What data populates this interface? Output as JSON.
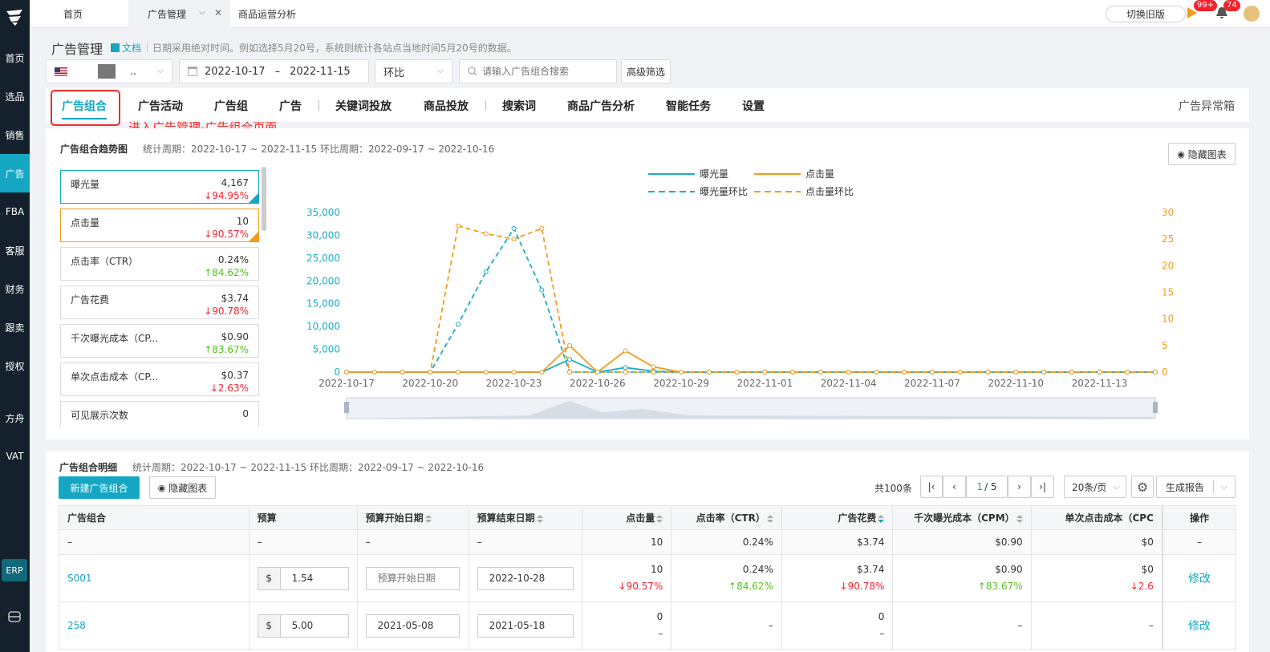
{
  "sidebar": {
    "items": [
      {
        "label": "首页",
        "active": false
      },
      {
        "label": "选品",
        "active": false
      },
      {
        "label": "销售",
        "active": false
      },
      {
        "label": "广告",
        "active": true
      },
      {
        "label": "FBA",
        "active": false
      },
      {
        "label": "客服",
        "active": false
      },
      {
        "label": "财务",
        "active": false
      },
      {
        "label": "跟卖",
        "active": false
      },
      {
        "label": "授权",
        "active": false
      },
      {
        "label": "方舟",
        "active": false
      },
      {
        "label": "VAT",
        "active": false
      }
    ],
    "erp_label": "ERP"
  },
  "tabs": [
    {
      "label": "首页"
    },
    {
      "label": "广告管理",
      "active": true
    },
    {
      "label": "商品运营分析"
    }
  ],
  "topbar": {
    "switch_old_label": "切换旧版",
    "badge_play": "99+",
    "badge_bell": "74"
  },
  "header": {
    "title": "广告管理",
    "doc_label": "文档",
    "hint": "日期采用绝对时间。例如选择5月20号，系统则统计各站点当地时间5月20号的数据。"
  },
  "filters": {
    "store_suffix": "..",
    "date_start": "2022-10-17",
    "date_sep": "–",
    "date_end": "2022-11-15",
    "compare": "环比",
    "search_placeholder": "请输入广告组合搜索",
    "advanced_label": "高级筛选"
  },
  "nav": [
    {
      "label": "广告组合",
      "active": true
    },
    {
      "label": "广告活动"
    },
    {
      "label": "广告组"
    },
    {
      "label": "广告"
    },
    {
      "label": "关键词投放"
    },
    {
      "label": "商品投放"
    },
    {
      "label": "搜索词"
    },
    {
      "label": "商品广告分析"
    },
    {
      "label": "智能任务"
    },
    {
      "label": "设置"
    }
  ],
  "nav_right": "广告异常箱",
  "annotation": "进入广告管理-广告组合页面",
  "trend": {
    "title": "广告组合趋势图",
    "meta": "统计周期：2022-10-17 ~ 2022-11-15 环比周期：2022-09-17 ~ 2022-10-16",
    "hide_label": "隐藏图表",
    "metrics": [
      {
        "name": "曝光量",
        "value": "4,167",
        "change": "↓94.95%",
        "dir": "down"
      },
      {
        "name": "点击量",
        "value": "10",
        "change": "↓90.57%",
        "dir": "down"
      },
      {
        "name": "点击率（CTR）",
        "value": "0.24%",
        "change": "↑84.62%",
        "dir": "up"
      },
      {
        "name": "广告花费",
        "value": "$3.74",
        "change": "↓90.78%",
        "dir": "down"
      },
      {
        "name": "千次曝光成本（CP...",
        "value": "$0.90",
        "change": "↑83.67%",
        "dir": "up"
      },
      {
        "name": "单次点击成本（CP...",
        "value": "$0.37",
        "change": "↓2.63%",
        "dir": "down"
      },
      {
        "name": "可见展示次数",
        "value": "0",
        "change": "–",
        "dir": "none"
      }
    ]
  },
  "chart_data": {
    "type": "line",
    "x": [
      "2022-10-17",
      "2022-10-18",
      "2022-10-19",
      "2022-10-20",
      "2022-10-21",
      "2022-10-22",
      "2022-10-23",
      "2022-10-24",
      "2022-10-25",
      "2022-10-26",
      "2022-10-27",
      "2022-10-28",
      "2022-10-29",
      "2022-10-30",
      "2022-10-31",
      "2022-11-01",
      "2022-11-02",
      "2022-11-03",
      "2022-11-04",
      "2022-11-05",
      "2022-11-06",
      "2022-11-07",
      "2022-11-08",
      "2022-11-09",
      "2022-11-10",
      "2022-11-11",
      "2022-11-12",
      "2022-11-13",
      "2022-11-14",
      "2022-11-15"
    ],
    "xtick_labels": [
      "2022-10-17",
      "2022-10-20",
      "2022-10-23",
      "2022-10-26",
      "2022-10-29",
      "2022-11-01",
      "2022-11-04",
      "2022-11-07",
      "2022-11-10",
      "2022-11-13"
    ],
    "y_left_ticks": [
      "0",
      "5,000",
      "10,000",
      "15,000",
      "20,000",
      "25,000",
      "30,000",
      "35,000"
    ],
    "y_right_ticks": [
      "0",
      "5",
      "10",
      "15",
      "20",
      "25",
      "30"
    ],
    "ylim_left": [
      0,
      35000
    ],
    "ylim_right": [
      0,
      30
    ],
    "series": [
      {
        "name": "曝光量",
        "axis": "left",
        "style": "solid",
        "color": "#1aadc6",
        "values": [
          0,
          0,
          0,
          0,
          0,
          0,
          0,
          0,
          2800,
          0,
          1000,
          200,
          0,
          0,
          0,
          0,
          0,
          0,
          0,
          0,
          0,
          0,
          0,
          0,
          0,
          0,
          0,
          0,
          0,
          0
        ]
      },
      {
        "name": "点击量",
        "axis": "right",
        "style": "solid",
        "color": "#f29b1c",
        "values": [
          0,
          0,
          0,
          0,
          0,
          0,
          0,
          0,
          5,
          0,
          4,
          1,
          0,
          0,
          0,
          0,
          0,
          0,
          0,
          0,
          0,
          0,
          0,
          0,
          0,
          0,
          0,
          0,
          0,
          0
        ]
      },
      {
        "name": "曝光量环比",
        "axis": "left",
        "style": "dashed",
        "color": "#1aadc6",
        "values": [
          0,
          0,
          0,
          0,
          10500,
          22000,
          31500,
          18000,
          0,
          0,
          0,
          0,
          0,
          0,
          0,
          0,
          0,
          0,
          0,
          0,
          0,
          0,
          0,
          0,
          0,
          0,
          0,
          0,
          0,
          0
        ]
      },
      {
        "name": "点击量环比",
        "axis": "right",
        "style": "dashed",
        "color": "#f29b1c",
        "values": [
          0,
          0,
          0,
          0,
          27.5,
          26,
          25,
          27,
          0,
          0,
          0,
          0,
          0,
          0,
          0,
          0,
          0,
          0,
          0,
          0,
          0,
          0,
          0,
          0,
          0,
          0,
          0,
          0,
          0,
          0
        ]
      }
    ],
    "legend": "top-center",
    "grid": false
  },
  "detail": {
    "title": "广告组合明细",
    "meta": "统计周期：2022-10-17 ~ 2022-11-15 环比周期：2022-09-17 ~ 2022-10-16",
    "new_btn": "新建广告组合",
    "hide_btn": "隐藏图表",
    "total": "共100条",
    "page_current": "1",
    "page_total": "/ 5",
    "page_size": "20条/页",
    "report_btn": "生成报告",
    "columns": [
      "广告组合",
      "预算",
      "预算开始日期",
      "预算结束日期",
      "点击量",
      "点击率（CTR）",
      "广告花费",
      "千次曝光成本（CPM）",
      "单次点击成本（CPC",
      "操作"
    ],
    "summary": {
      "name": "–",
      "budget": "–",
      "start": "–",
      "end": "–",
      "clicks": "10",
      "ctr": "0.24%",
      "spend": "$3.74",
      "cpm": "$0.90",
      "cpc": "$0",
      "op": "–"
    },
    "rows": [
      {
        "name": "S001",
        "currency": "$",
        "budget": "1.54",
        "start": "",
        "start_placeholder": "预算开始日期",
        "end": "2022-10-28",
        "clicks": "10",
        "clicks_chg": "↓90.57%",
        "ctr": "0.24%",
        "ctr_chg": "↑84.62%",
        "spend": "$3.74",
        "spend_chg": "↓90.78%",
        "cpm": "$0.90",
        "cpm_chg": "↑83.67%",
        "cpc": "$0",
        "cpc_chg": "↓2.6",
        "op": "修改"
      },
      {
        "name": "258",
        "currency": "$",
        "budget": "5.00",
        "start": "2021-05-08",
        "end": "2021-05-18",
        "clicks": "0",
        "clicks_chg": "–",
        "ctr": "–",
        "spend": "0",
        "spend_chg": "–",
        "cpm": "–",
        "cpc": "–",
        "op": "修改"
      }
    ]
  },
  "colors": {
    "accent": "#14a6c2",
    "sidebar": "#14212c",
    "down": "#f5222d",
    "up": "#52c41a",
    "orange": "#f29b1c"
  }
}
